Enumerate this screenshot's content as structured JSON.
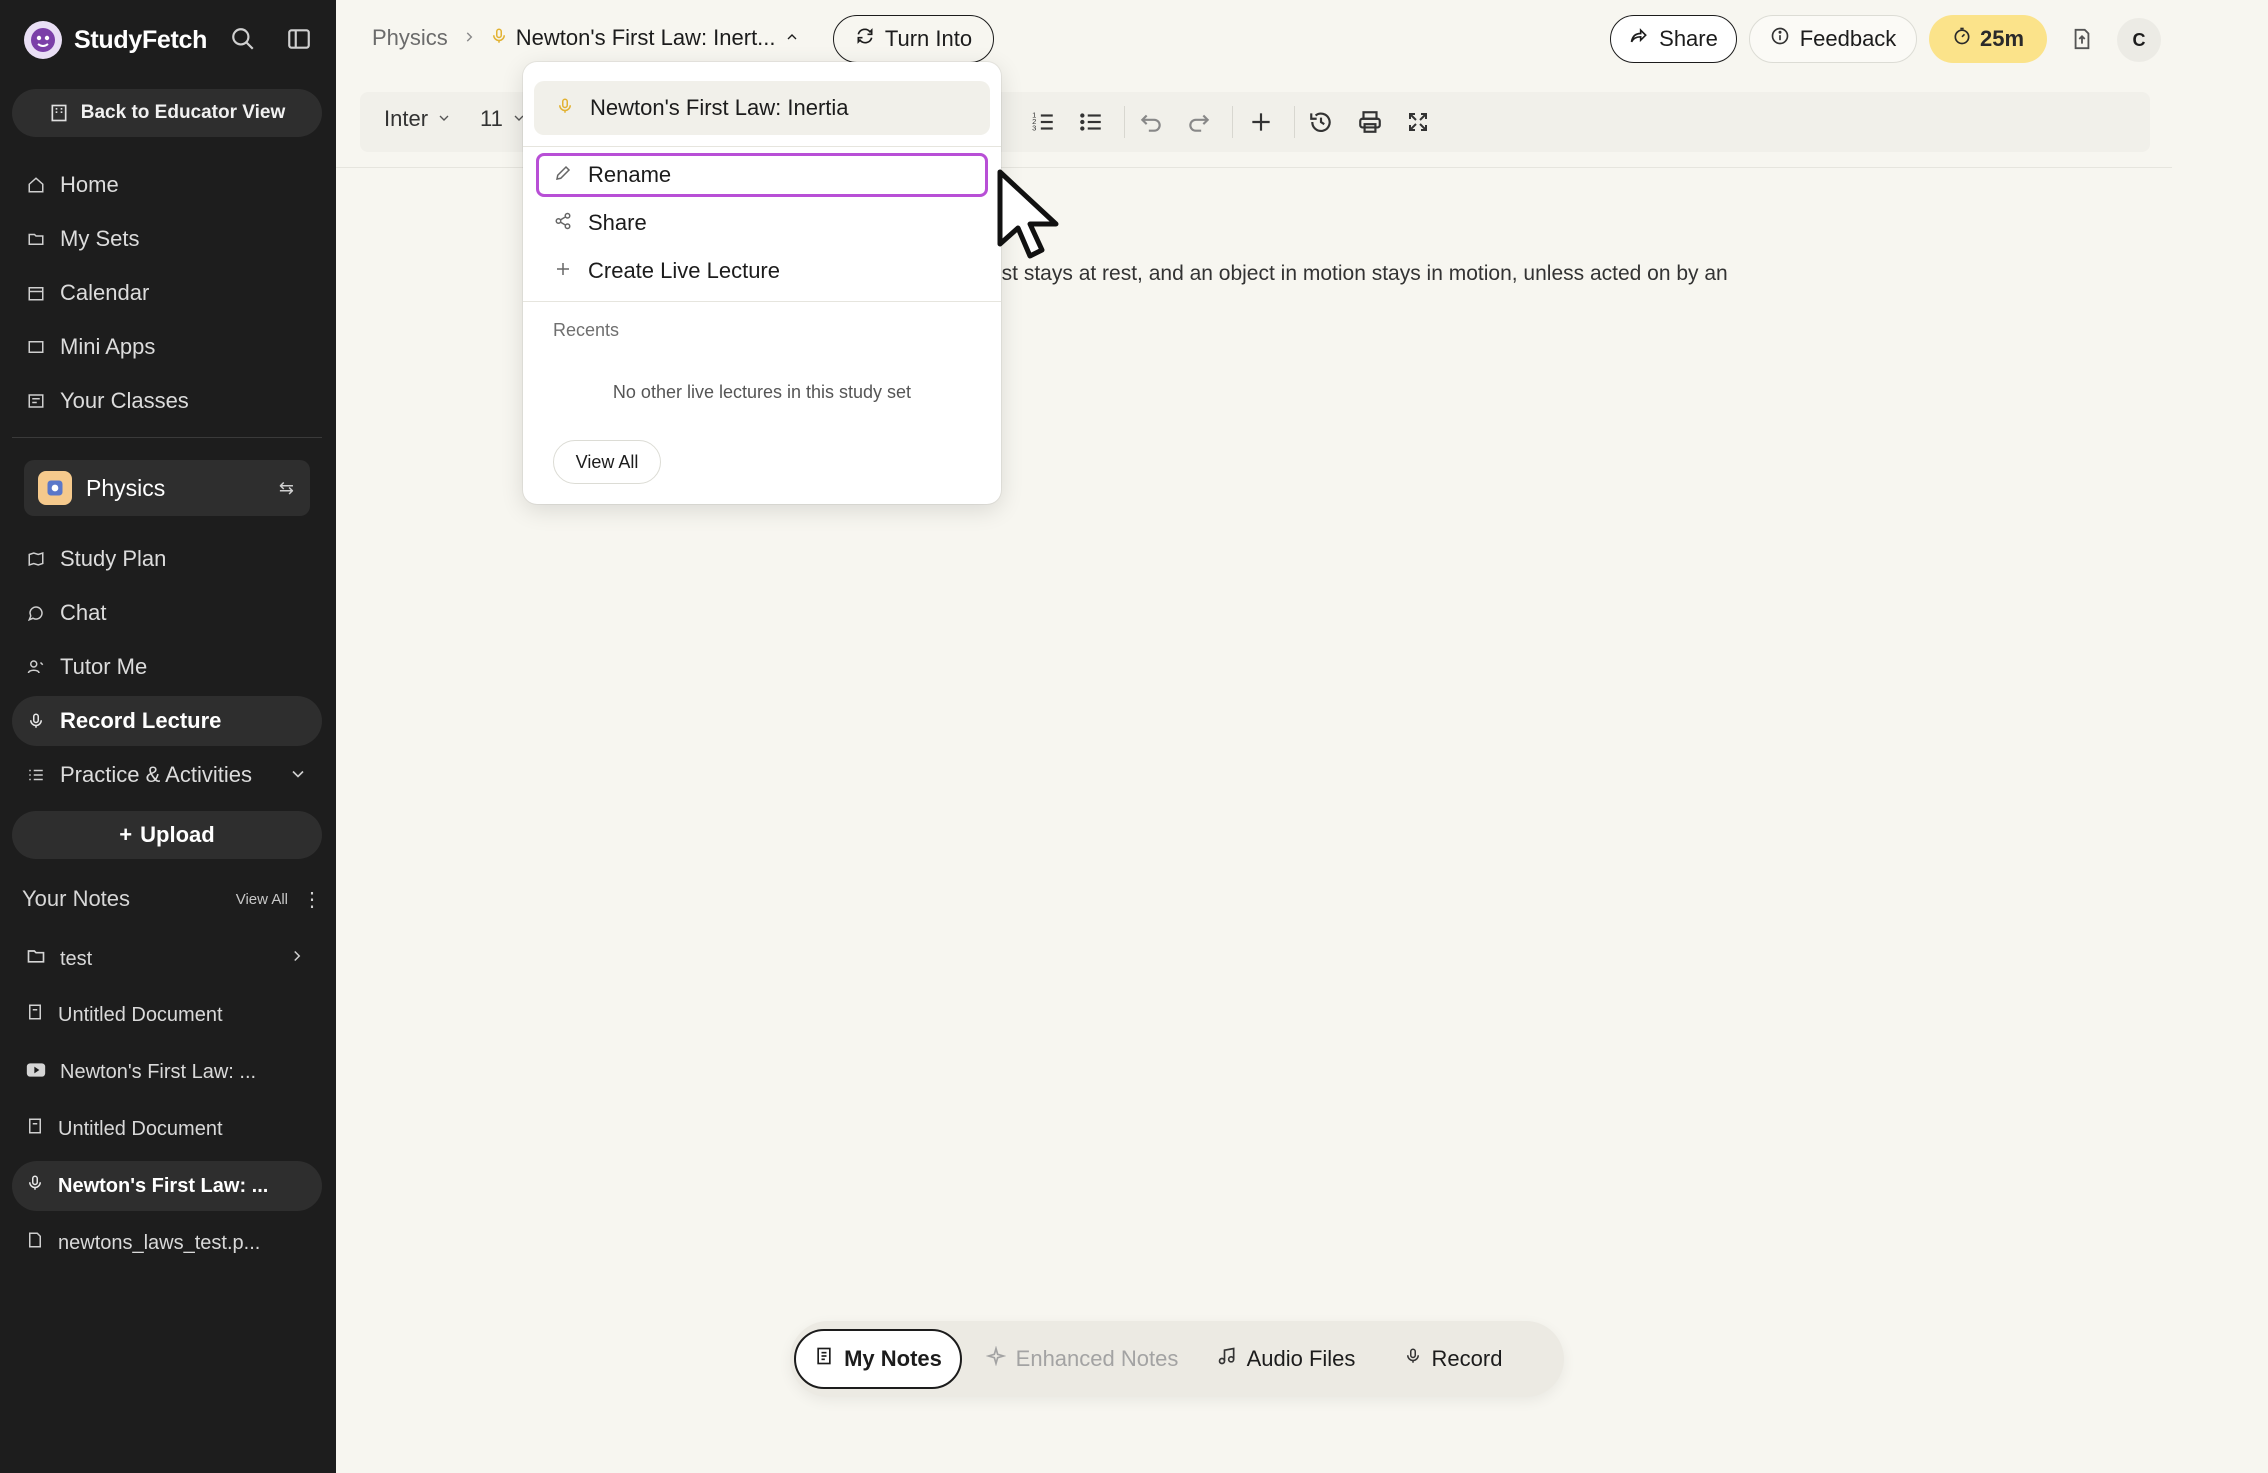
{
  "app": {
    "brand_name": "StudyFetch",
    "accent_color": "#b84fd6"
  },
  "sidebar": {
    "educator_button": "Back to Educator View",
    "nav": [
      {
        "label": "Home",
        "icon": "home-icon"
      },
      {
        "label": "My Sets",
        "icon": "folder-icon"
      },
      {
        "label": "Calendar",
        "icon": "calendar-icon"
      },
      {
        "label": "Mini Apps",
        "icon": "apps-icon"
      },
      {
        "label": "Your Classes",
        "icon": "classes-icon"
      }
    ],
    "current_set": "Physics",
    "set_nav": [
      {
        "label": "Study Plan",
        "icon": "map-icon"
      },
      {
        "label": "Chat",
        "icon": "chat-icon"
      },
      {
        "label": "Tutor Me",
        "icon": "tutor-icon"
      },
      {
        "label": "Record Lecture",
        "icon": "mic-icon"
      },
      {
        "label": "Practice & Activities",
        "icon": "practice-icon"
      }
    ],
    "upload_label": "Upload",
    "notes_title": "Your Notes",
    "notes_view_all": "View All",
    "notes": [
      {
        "label": "test",
        "icon": "folder-icon"
      },
      {
        "label": "Untitled Document",
        "icon": "document-icon"
      },
      {
        "label": "Newton's First Law: ...",
        "icon": "youtube-icon"
      },
      {
        "label": "Untitled Document",
        "icon": "document-icon"
      },
      {
        "label": "Newton's First Law: ...",
        "icon": "mic-icon"
      },
      {
        "label": "newtons_laws_test.p...",
        "icon": "pdf-icon"
      }
    ]
  },
  "header": {
    "breadcrumb_root": "Physics",
    "breadcrumb_current": "Newton's First Law: Inert...",
    "turn_into": "Turn Into",
    "share": "Share",
    "feedback": "Feedback",
    "timer": "25m",
    "avatar_initial": "C"
  },
  "toolbar": {
    "font": "Inter",
    "size": "11"
  },
  "document": {
    "visible_text": "est stays at rest, and an object in motion stays in motion, unless acted on by an"
  },
  "dropdown": {
    "current_title": "Newton's First Law: Inertia",
    "items": [
      "Rename",
      "Share",
      "Create Live Lecture"
    ],
    "recents_label": "Recents",
    "empty_text": "No other live lectures in this study set",
    "view_all": "View All"
  },
  "bottom_tabs": [
    "My Notes",
    "Enhanced Notes",
    "Audio Files",
    "Record"
  ]
}
